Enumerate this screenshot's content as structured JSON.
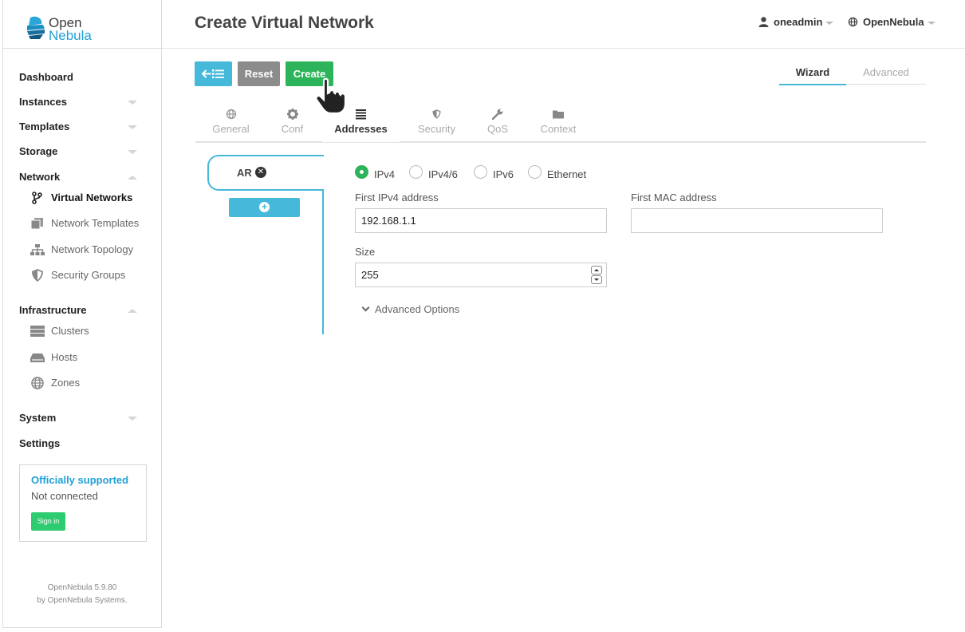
{
  "brand": {
    "line1": "Open",
    "line2": "Nebula"
  },
  "sidebar": {
    "items": [
      {
        "label": "Dashboard"
      },
      {
        "label": "Instances"
      },
      {
        "label": "Templates"
      },
      {
        "label": "Storage"
      },
      {
        "label": "Network"
      },
      {
        "label": "Infrastructure"
      },
      {
        "label": "System"
      },
      {
        "label": "Settings"
      }
    ],
    "network_sub": [
      {
        "label": "Virtual Networks",
        "icon": "fork-icon"
      },
      {
        "label": "Network Templates",
        "icon": "copy-icon"
      },
      {
        "label": "Network Topology",
        "icon": "sitemap-icon"
      },
      {
        "label": "Security Groups",
        "icon": "shield-icon"
      }
    ],
    "infra_sub": [
      {
        "label": "Clusters",
        "icon": "server-icon"
      },
      {
        "label": "Hosts",
        "icon": "hdd-icon"
      },
      {
        "label": "Zones",
        "icon": "globe-icon"
      }
    ],
    "support": {
      "title": "Officially supported",
      "status": "Not connected",
      "signin": "Sign in"
    },
    "version": "OpenNebula 5.9.80",
    "by": "by OpenNebula Systems."
  },
  "header": {
    "title": "Create Virtual Network",
    "user": "oneadmin",
    "zone": "OpenNebula"
  },
  "toolbar": {
    "reset": "Reset",
    "create": "Create"
  },
  "modes": {
    "wizard": "Wizard",
    "advanced": "Advanced"
  },
  "tabs": [
    {
      "label": "General",
      "icon": "globe-icon"
    },
    {
      "label": "Conf",
      "icon": "cog-icon"
    },
    {
      "label": "Addresses",
      "icon": "list-icon"
    },
    {
      "label": "Security",
      "icon": "shield-icon"
    },
    {
      "label": "QoS",
      "icon": "wrench-icon"
    },
    {
      "label": "Context",
      "icon": "folder-icon"
    }
  ],
  "ar": {
    "label": "AR"
  },
  "form": {
    "types": [
      "IPv4",
      "IPv4/6",
      "IPv6",
      "Ethernet"
    ],
    "selected_type": "IPv4",
    "first_ipv4_label": "First IPv4 address",
    "first_ipv4_value": "192.168.1.1",
    "first_mac_label": "First MAC address",
    "first_mac_value": "",
    "size_label": "Size",
    "size_value": "255",
    "advanced_options": "Advanced Options"
  },
  "colors": {
    "accent": "#46b8da",
    "create": "#2db45a",
    "reset": "#8c8c8c",
    "support_btn": "#2ecc71"
  }
}
